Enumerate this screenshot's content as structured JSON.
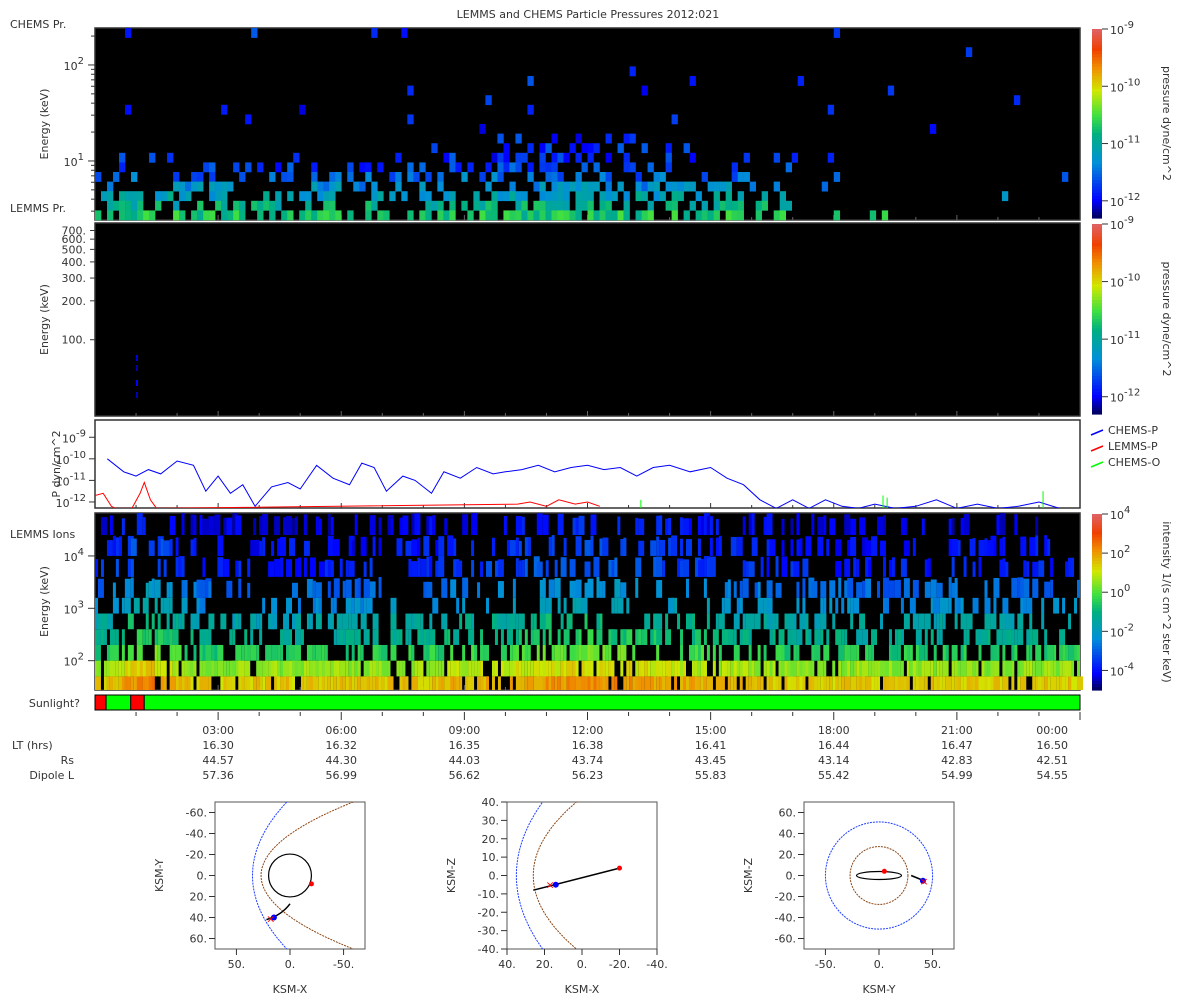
{
  "title": "LEMMS and CHEMS Particle Pressures  2012:021",
  "chart_data": [
    {
      "id": "chems",
      "type": "heatmap",
      "panel_label": "CHEMS Pr.",
      "ylabel": "Energy (keV)",
      "ylog_range": [
        0.385,
        2.385
      ],
      "yticks": [
        {
          "v": 2,
          "base": "10",
          "exp": "2"
        },
        {
          "v": 1,
          "base": "10",
          "exp": "1"
        }
      ],
      "xlim_hours": [
        0,
        24
      ],
      "colorbar": {
        "label": "pressure dyne/cm^2",
        "log_range": [
          -12.3,
          -9
        ],
        "ticks": [
          {
            "v": -9,
            "base": "10",
            "exp": "-9"
          },
          {
            "v": -10,
            "base": "10",
            "exp": "-10"
          },
          {
            "v": -11,
            "base": "10",
            "exp": "-11"
          },
          {
            "v": -12,
            "base": "10",
            "exp": "-12"
          }
        ]
      }
    },
    {
      "id": "lemms",
      "type": "heatmap",
      "panel_label": "LEMMS Pr.",
      "ylabel": "Energy (keV)",
      "ylog_range": [
        1.41,
        2.903
      ],
      "yticks": [
        {
          "v": 700,
          "label": "700."
        },
        {
          "v": 600,
          "label": "600."
        },
        {
          "v": 500,
          "label": "500."
        },
        {
          "v": 400,
          "label": "400."
        },
        {
          "v": 300,
          "label": "300."
        },
        {
          "v": 200,
          "label": "200."
        },
        {
          "v": 100,
          "label": "100."
        }
      ],
      "xlim_hours": [
        0,
        24
      ],
      "colorbar": {
        "label": "pressure dyne/cm^2",
        "log_range": [
          -12.3,
          -9
        ],
        "ticks": [
          {
            "v": -9,
            "base": "10",
            "exp": "-9"
          },
          {
            "v": -10,
            "base": "10",
            "exp": "-10"
          },
          {
            "v": -11,
            "base": "10",
            "exp": "-11"
          },
          {
            "v": -12,
            "base": "10",
            "exp": "-12"
          }
        ]
      }
    },
    {
      "id": "pressure",
      "type": "line",
      "ylabel": "P dyn/cm^2",
      "ylog_range": [
        -12.28,
        -8.2
      ],
      "yticks": [
        {
          "v": -9,
          "base": "10",
          "exp": "-9"
        },
        {
          "v": -10,
          "base": "10",
          "exp": "-10"
        },
        {
          "v": -11,
          "base": "10",
          "exp": "-11"
        },
        {
          "v": -12,
          "base": "10",
          "exp": "-12"
        }
      ],
      "legend_position": "right",
      "series": [
        {
          "name": "CHEMS-P",
          "color": "#0000ff",
          "x": [
            0.3,
            0.7,
            1.0,
            1.3,
            1.6,
            2.0,
            2.4,
            2.7,
            3.0,
            3.3,
            3.6,
            3.9,
            4.3,
            4.7,
            5.0,
            5.4,
            5.8,
            6.2,
            6.5,
            6.8,
            7.1,
            7.5,
            7.8,
            8.2,
            8.5,
            8.9,
            9.3,
            9.7,
            10.0,
            10.4,
            10.8,
            11.2,
            11.6,
            12.0,
            12.4,
            12.8,
            13.2,
            13.6,
            14.0,
            14.5,
            15.0,
            15.4,
            15.8,
            16.2,
            16.6,
            17.0,
            17.4,
            17.8,
            18.2,
            18.6,
            19.0,
            19.5,
            20.0,
            20.5,
            21.0,
            21.5,
            22.0,
            22.5,
            23.0,
            23.5
          ],
          "log_values": [
            -10.0,
            -10.6,
            -10.8,
            -10.5,
            -10.7,
            -10.1,
            -10.3,
            -11.5,
            -10.8,
            -11.6,
            -11.2,
            -12.2,
            -11.3,
            -11.1,
            -11.4,
            -10.3,
            -10.9,
            -11.2,
            -10.2,
            -10.4,
            -11.5,
            -10.8,
            -11.0,
            -11.6,
            -10.6,
            -10.9,
            -10.4,
            -10.7,
            -10.6,
            -10.5,
            -10.3,
            -10.6,
            -10.4,
            -10.3,
            -10.5,
            -10.4,
            -10.8,
            -10.4,
            -10.3,
            -10.6,
            -10.4,
            -10.9,
            -11.2,
            -11.9,
            -12.3,
            -11.9,
            -12.3,
            -11.9,
            -12.2,
            -12.3,
            -12.1,
            -12.3,
            -12.2,
            -11.9,
            -12.3,
            -12.1,
            -12.3,
            -12.2,
            -12.0,
            -12.3
          ]
        },
        {
          "name": "LEMMS-P",
          "color": "#ff0000",
          "x": [
            0.0,
            0.2,
            0.4,
            0.5,
            0.9,
            1.1,
            1.2,
            1.35,
            1.5,
            10.3,
            10.6,
            11.0,
            11.3,
            11.7,
            12.0,
            12.3
          ],
          "log_values": [
            -11.7,
            -11.6,
            -12.2,
            -12.3,
            -12.3,
            -11.6,
            -11.1,
            -11.9,
            -12.3,
            -12.1,
            -12.0,
            -12.2,
            -11.9,
            -12.1,
            -12.0,
            -12.2
          ]
        },
        {
          "name": "CHEMS-O",
          "color": "#00ff00",
          "x": [
            13.3,
            19.2,
            19.3,
            23.1
          ],
          "log_values": [
            -11.9,
            -11.7,
            -11.8,
            -11.5
          ]
        }
      ]
    },
    {
      "id": "lemms-ions",
      "type": "heatmap",
      "panel_label": "LEMMS Ions",
      "ylabel": "Energy (keV)",
      "ylog_range": [
        1.44,
        4.82
      ],
      "yticks": [
        {
          "v": 4,
          "base": "10",
          "exp": "4"
        },
        {
          "v": 3,
          "base": "10",
          "exp": "3"
        },
        {
          "v": 2,
          "base": "10",
          "exp": "2"
        }
      ],
      "xlim_hours": [
        0,
        24
      ],
      "colorbar": {
        "label": "intensity 1/(s cm^2 ster keV)",
        "log_range": [
          -5,
          4
        ],
        "ticks": [
          {
            "v": 4,
            "base": "10",
            "exp": "4"
          },
          {
            "v": 2,
            "base": "10",
            "exp": "2"
          },
          {
            "v": 0,
            "base": "10",
            "exp": "0"
          },
          {
            "v": -2,
            "base": "10",
            "exp": "-2"
          },
          {
            "v": -4,
            "base": "10",
            "exp": "-4"
          }
        ]
      }
    }
  ],
  "sunlight": {
    "label": "Sunlight?",
    "segments": [
      {
        "start": 0,
        "end": 0.27,
        "color": "#ff0000"
      },
      {
        "start": 0.27,
        "end": 0.87,
        "color": "#00ff00"
      },
      {
        "start": 0.87,
        "end": 1.2,
        "color": "#ff0000"
      },
      {
        "start": 1.2,
        "end": 24,
        "color": "#00ff00"
      }
    ]
  },
  "ephemeris": {
    "row_labels": [
      "LT (hrs)",
      "Rs",
      "Dipole L"
    ],
    "columns": [
      {
        "time": "03:00",
        "values": [
          "16.30",
          "44.57",
          "57.36"
        ]
      },
      {
        "time": "06:00",
        "values": [
          "16.32",
          "44.30",
          "56.99"
        ]
      },
      {
        "time": "09:00",
        "values": [
          "16.35",
          "44.03",
          "56.62"
        ]
      },
      {
        "time": "12:00",
        "values": [
          "16.38",
          "43.74",
          "56.23"
        ]
      },
      {
        "time": "15:00",
        "values": [
          "16.41",
          "43.45",
          "55.83"
        ]
      },
      {
        "time": "18:00",
        "values": [
          "16.44",
          "43.14",
          "55.42"
        ]
      },
      {
        "time": "21:00",
        "values": [
          "16.47",
          "42.83",
          "54.99"
        ]
      },
      {
        "time": "00:00",
        "values": [
          "16.50",
          "42.51",
          "54.55"
        ]
      }
    ]
  },
  "orbits": [
    {
      "xlabel": "KSM-X",
      "ylabel": "KSM-Y",
      "xticks": [
        "50.",
        "0.",
        "-50."
      ],
      "xtick_vals": [
        50,
        0,
        -50
      ],
      "yticks": [
        "-60.",
        "-40.",
        "-20.",
        "0.",
        "20.",
        "40.",
        "60."
      ],
      "ytick_vals": [
        -60,
        -40,
        -20,
        0,
        20,
        40,
        60
      ]
    },
    {
      "xlabel": "KSM-X",
      "ylabel": "KSM-Z",
      "xticks": [
        "40.",
        "20.",
        "0.",
        "-20.",
        "-40."
      ],
      "xtick_vals": [
        40,
        20,
        0,
        -20,
        -40
      ],
      "yticks": [
        "40.",
        "30.",
        "20.",
        "10.",
        "0.",
        "-10.",
        "-20.",
        "-30.",
        "-40."
      ],
      "ytick_vals": [
        40,
        30,
        20,
        10,
        0,
        -10,
        -20,
        -30,
        -40
      ]
    },
    {
      "xlabel": "KSM-Y",
      "ylabel": "KSM-Z",
      "xticks": [
        "-50.",
        "0.",
        "50."
      ],
      "xtick_vals": [
        -50,
        0,
        50
      ],
      "yticks": [
        "60.",
        "40.",
        "20.",
        "0.",
        "-20.",
        "-40.",
        "-60."
      ],
      "ytick_vals": [
        60,
        40,
        20,
        0,
        -20,
        -40,
        -60
      ]
    }
  ]
}
